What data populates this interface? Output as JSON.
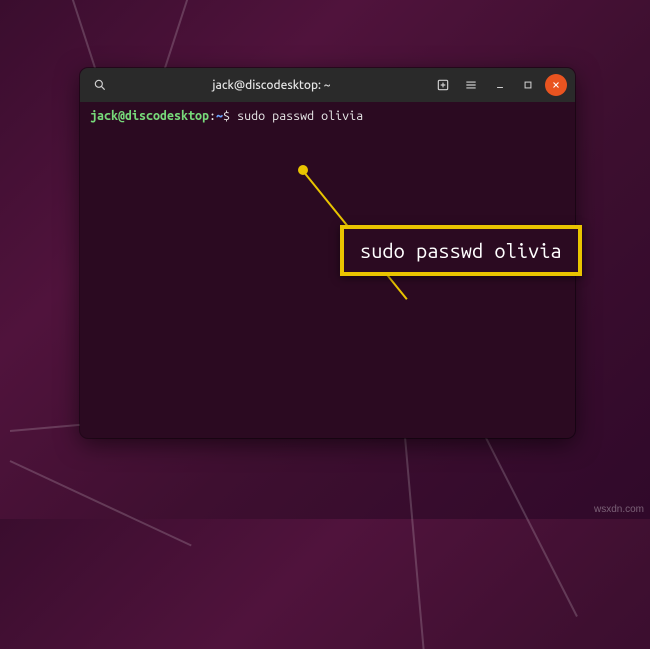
{
  "titlebar": {
    "title": "jack@discodesktop: ~"
  },
  "prompt": {
    "user_host": "jack@discodesktop",
    "colon": ":",
    "path": "~",
    "symbol": "$ "
  },
  "command": "sudo passwd olivia",
  "callout": {
    "text": "sudo passwd olivia"
  },
  "icons": {
    "search": "search-icon",
    "new_tab": "new-tab-icon",
    "menu": "hamburger-menu-icon",
    "minimize": "minimize-icon",
    "maximize": "maximize-icon",
    "close": "close-icon"
  },
  "watermark": "wsxdn.com"
}
